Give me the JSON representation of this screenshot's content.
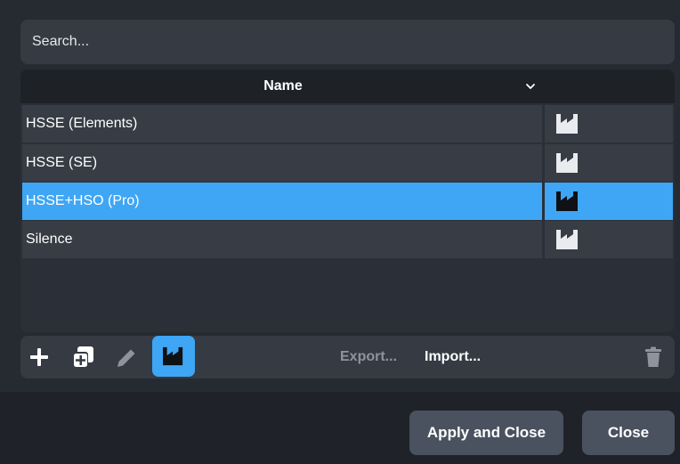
{
  "search": {
    "placeholder": "Search..."
  },
  "table": {
    "columns": {
      "name": "Name"
    },
    "rows": [
      {
        "name": "HSSE (Elements)",
        "selected": false
      },
      {
        "name": "HSSE (SE)",
        "selected": false
      },
      {
        "name": "HSSE+HSO (Pro)",
        "selected": true
      },
      {
        "name": "Silence",
        "selected": false
      }
    ]
  },
  "toolbar": {
    "add_icon": "plus-icon",
    "duplicate_icon": "duplicate-icon",
    "edit_icon": "pencil-icon",
    "factory_icon": "factory-icon",
    "export_label": "Export...",
    "import_label": "Import...",
    "delete_icon": "trash-icon"
  },
  "footer": {
    "apply_close_label": "Apply and Close",
    "close_label": "Close"
  },
  "colors": {
    "accent": "#3ea6f4",
    "background": "#1f2329",
    "row": "#373c45",
    "disabled_text": "#8f949c"
  }
}
